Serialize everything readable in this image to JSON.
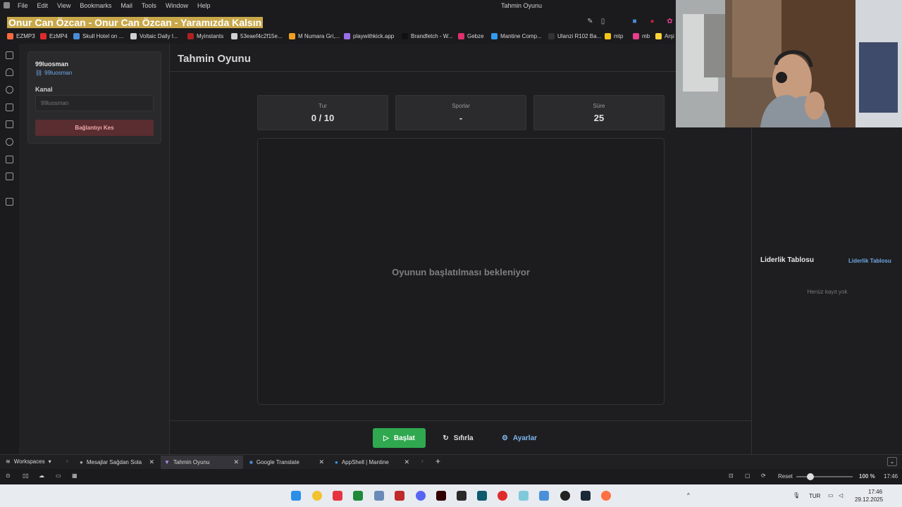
{
  "menubar": {
    "items": [
      "File",
      "Edit",
      "View",
      "Bookmarks",
      "Mail",
      "Tools",
      "Window",
      "Help"
    ],
    "window_title": "Tahmin Oyunu"
  },
  "address": {
    "url_text": "Onur Can Özcan - Onur Can Özcan - Yaramızda Kalsın"
  },
  "bookmarks": [
    {
      "label": "EZMP3",
      "color": "#ff6a3d"
    },
    {
      "label": "EzMP4",
      "color": "#e02b2b"
    },
    {
      "label": "Skull Hotel on ...",
      "color": "#4a8cd8"
    },
    {
      "label": "Voltaic Daily I...",
      "color": "#d0d0d0"
    },
    {
      "label": "Myinstants",
      "color": "#b02020"
    },
    {
      "label": "53eaef4c2f15e...",
      "color": "#d0d0d0"
    },
    {
      "label": "M Numara Gri,...",
      "color": "#f0a020"
    },
    {
      "label": "playwithkick.app",
      "color": "#9a6ee8"
    },
    {
      "label": "Brandfetch - W...",
      "color": "#111111"
    },
    {
      "label": "Gebze",
      "color": "#e1306c"
    },
    {
      "label": "Mantine Comp...",
      "color": "#339af0"
    },
    {
      "label": "Ulanzi R102 Ba...",
      "color": "#333333"
    },
    {
      "label": "mtp",
      "color": "#f5c518"
    },
    {
      "label": "mb",
      "color": "#e83e8c"
    },
    {
      "label": "Arşi",
      "color": "#ffd43b"
    }
  ],
  "connection": {
    "username": "99luosman",
    "link": "99luosman",
    "channel_label": "Kanal",
    "channel_placeholder": "99luosman",
    "disconnect_label": "Bağlantıyı Kes"
  },
  "page": {
    "title": "Tahmin Oyunu"
  },
  "stats": [
    {
      "label": "Tur",
      "value": "0 / 10"
    },
    {
      "label": "Sporlar",
      "value": "-"
    },
    {
      "label": "Süre",
      "value": "25"
    }
  ],
  "game": {
    "waiting_text": "Oyunun başlatılması bekleniyor"
  },
  "actions": {
    "start": "Başlat",
    "reset": "Sıfırla",
    "settings": "Ayarlar"
  },
  "leaderboard": {
    "title": "Liderlik Tablosu",
    "link": "Liderlik Tablosu",
    "empty": "Henüz kayıt yok"
  },
  "workspace": {
    "label": "Workspaces",
    "tabs": [
      {
        "title": "Mesajlar Sağdan Sola",
        "active": false
      },
      {
        "title": "Tahmin Oyunu",
        "active": true
      },
      {
        "title": "Google Translate",
        "active": false
      },
      {
        "title": "AppShell | Mantine",
        "active": false
      }
    ]
  },
  "statusbar": {
    "reset_label": "Reset",
    "zoom": "100 %",
    "time": "17:46",
    "zoom_level": 0.25
  },
  "taskbar": {
    "lang": "TUR",
    "time": "17:46",
    "date": "29.12.2025"
  },
  "colors": {
    "accent_green": "#2fa84f",
    "link_blue": "#7fb7f0",
    "danger": "#5a2d31"
  }
}
